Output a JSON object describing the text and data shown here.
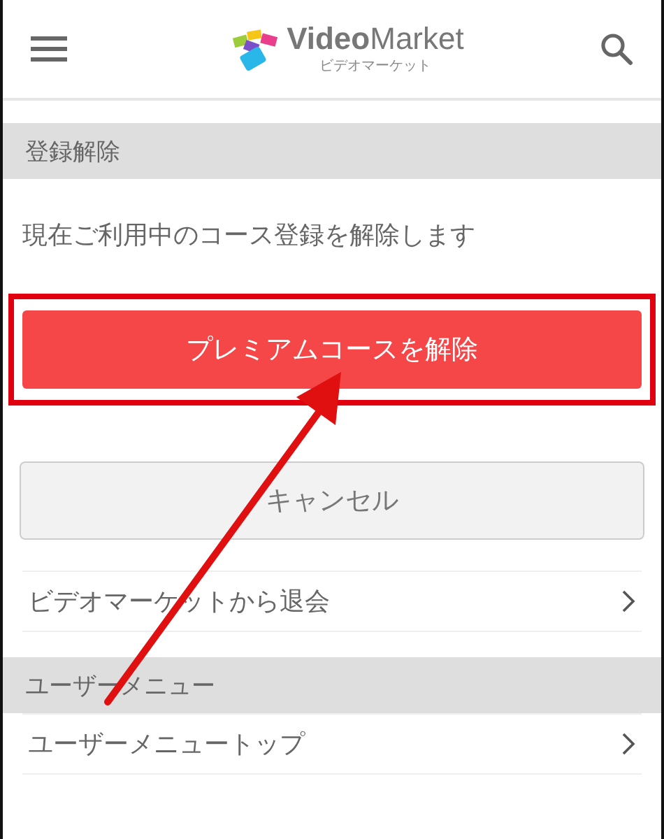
{
  "header": {
    "logo": "**Video**Market",
    "logo_sub": "ビデオマーケット"
  },
  "sections": [
    {
      "title": "登録解除",
      "description": "現在ご利用中のコース登録を解除します",
      "primary_button": {
        "label": "プレミアムコースを解除",
        "highlighted": true
      },
      "secondary_button": {
        "label": "キャンセル"
      },
      "items": [
        {
          "label": "ビデオマーケットから退会"
        }
      ]
    },
    {
      "title": "ユーザーメニュー",
      "items": [
        {
          "label": "ユーザーメニュートップ"
        }
      ]
    }
  ],
  "annotation": {
    "arrow": true
  }
}
